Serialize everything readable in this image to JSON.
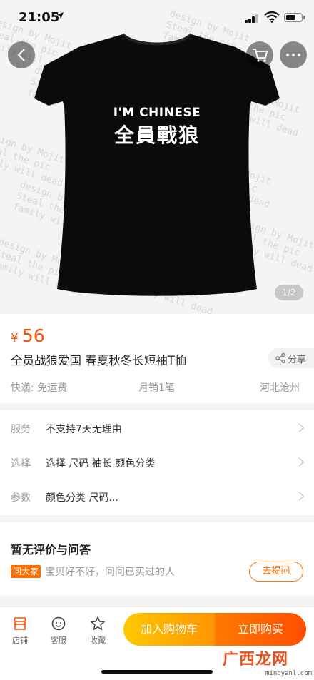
{
  "status_bar": {
    "time": "21:05",
    "location_icon": "location-arrow-icon",
    "battery_level": 0.65
  },
  "hero": {
    "shirt_line1": "I'M CHINESE",
    "shirt_line2": "全員戰狼",
    "watermark_line1": "design by Mojit",
    "watermark_line2": "Steal the pic",
    "watermark_line3": "family will dead",
    "pager": "1/2",
    "shirt_color": "#0b0b0b"
  },
  "product": {
    "currency": "¥",
    "price": "56",
    "title": "全员战狼爱国 春夏秋冬长短袖T恤",
    "share_label": "分享",
    "shipping": "快递: 免运费",
    "monthly_sales": "月销1笔",
    "origin": "河北沧州"
  },
  "properties": [
    {
      "label": "服务",
      "value": "不支持7天无理由"
    },
    {
      "label": "选择",
      "value": "选择  尺码 袖长 颜色分类"
    },
    {
      "label": "参数",
      "value": "颜色分类 尺码..."
    }
  ],
  "reviews": {
    "title": "暂无评价与问答",
    "ask_tag": "问大家",
    "ask_hint": "宝贝好不好，问问已买过的人",
    "ask_button": "去提问"
  },
  "bottom_bar": {
    "shop": "店铺",
    "service": "客服",
    "favorite": "收藏",
    "add_to_cart": "加入购物车",
    "buy_now": "立即购买"
  },
  "site_watermark": {
    "logo": "广西龙网",
    "url": "mingyanl.com"
  },
  "colors": {
    "accent": "#ff5000",
    "orange_start": "#ffc900",
    "orange_end": "#ff4e00"
  }
}
